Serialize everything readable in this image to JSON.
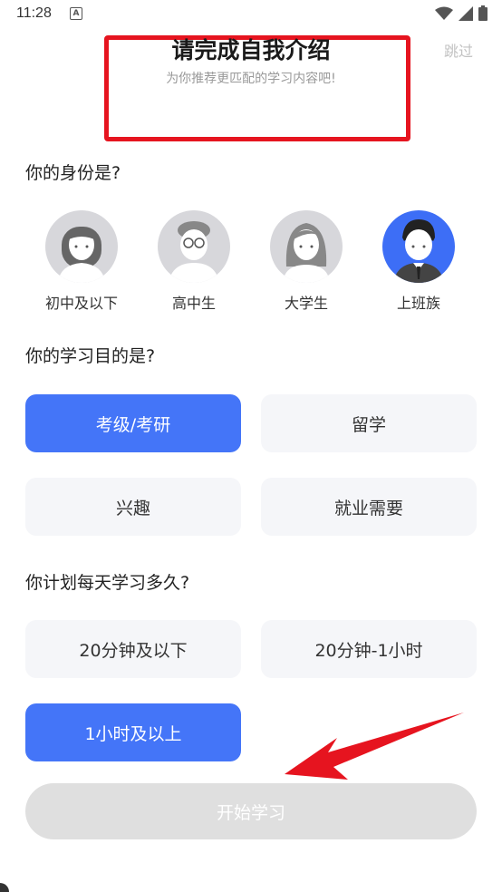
{
  "status": {
    "time": "11:28"
  },
  "skip_label": "跳过",
  "header": {
    "title": "请完成自我介绍",
    "subtitle": "为你推荐更匹配的学习内容吧!"
  },
  "identity": {
    "question": "你的身份是?",
    "options": [
      {
        "label": "初中及以下",
        "selected": false,
        "icon": "girl-avatar-icon"
      },
      {
        "label": "高中生",
        "selected": false,
        "icon": "boy-glasses-avatar-icon"
      },
      {
        "label": "大学生",
        "selected": false,
        "icon": "young-woman-avatar-icon"
      },
      {
        "label": "上班族",
        "selected": true,
        "icon": "office-man-avatar-icon"
      }
    ]
  },
  "purpose": {
    "question": "你的学习目的是?",
    "options": [
      {
        "label": "考级/考研",
        "selected": true
      },
      {
        "label": "留学",
        "selected": false
      },
      {
        "label": "兴趣",
        "selected": false
      },
      {
        "label": "就业需要",
        "selected": false
      }
    ]
  },
  "duration": {
    "question": "你计划每天学习多久?",
    "options": [
      {
        "label": "20分钟及以下",
        "selected": false
      },
      {
        "label": "20分钟-1小时",
        "selected": false
      },
      {
        "label": "1小时及以上",
        "selected": true
      }
    ]
  },
  "start_label": "开始学习",
  "colors": {
    "accent": "#4475f8",
    "highlight_border": "#e6141f",
    "disabled": "#dfdfdf"
  }
}
